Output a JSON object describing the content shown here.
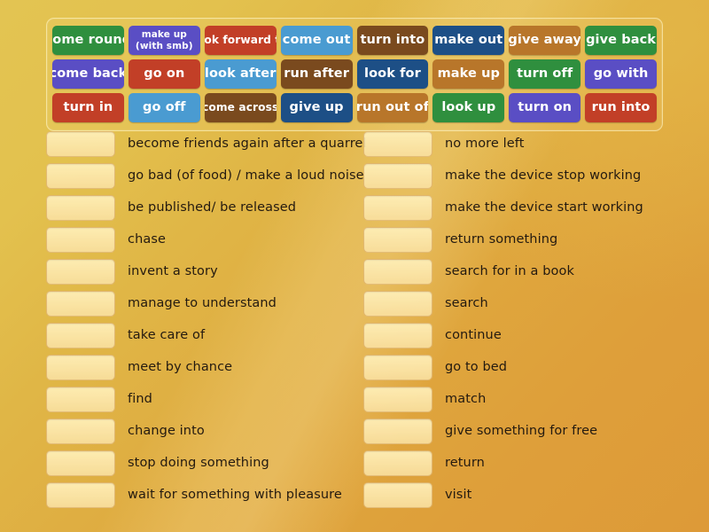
{
  "activity": {
    "type": "match-up",
    "background": {
      "gradient_from": "#e3c452",
      "gradient_to": "#dd9a38"
    }
  },
  "word_bank": {
    "rows": [
      [
        {
          "label": "come round",
          "color": "#2f8f3e",
          "style": "normal"
        },
        {
          "label": "make up\n(with smb)",
          "line1": "make up",
          "line2": "(with smb)",
          "color": "#5a4ec4",
          "style": "twoline"
        },
        {
          "label": "look forward to",
          "color": "#c23f27",
          "style": "small"
        },
        {
          "label": "come out",
          "color": "#4a9bd1",
          "style": "normal"
        },
        {
          "label": "turn into",
          "color": "#7a4a1e",
          "style": "normal"
        },
        {
          "label": "make out",
          "color": "#1d4f86",
          "style": "normal"
        },
        {
          "label": "give away",
          "color": "#b8762a",
          "style": "normal"
        },
        {
          "label": "give back",
          "color": "#2f8f3e",
          "style": "normal"
        }
      ],
      [
        {
          "label": "come back",
          "color": "#5a4ec4",
          "style": "normal"
        },
        {
          "label": "go on",
          "color": "#c23f27",
          "style": "normal"
        },
        {
          "label": "look after",
          "color": "#4a9bd1",
          "style": "normal"
        },
        {
          "label": "run after",
          "color": "#7a4a1e",
          "style": "normal"
        },
        {
          "label": "look for",
          "color": "#1d4f86",
          "style": "normal"
        },
        {
          "label": "make up",
          "color": "#b8762a",
          "style": "normal"
        },
        {
          "label": "turn off",
          "color": "#2f8f3e",
          "style": "normal"
        },
        {
          "label": "go with",
          "color": "#5a4ec4",
          "style": "normal"
        }
      ],
      [
        {
          "label": "turn in",
          "color": "#c23f27",
          "style": "normal"
        },
        {
          "label": "go off",
          "color": "#4a9bd1",
          "style": "normal"
        },
        {
          "label": "come across",
          "color": "#7a4a1e",
          "style": "small"
        },
        {
          "label": "give up",
          "color": "#1d4f86",
          "style": "normal"
        },
        {
          "label": "run out of",
          "color": "#b8762a",
          "style": "normal"
        },
        {
          "label": "look up",
          "color": "#2f8f3e",
          "style": "normal"
        },
        {
          "label": "turn on",
          "color": "#5a4ec4",
          "style": "normal"
        },
        {
          "label": "run into",
          "color": "#c23f27",
          "style": "normal"
        }
      ]
    ]
  },
  "definitions": {
    "left": [
      {
        "text": "become friends again after a quarrel",
        "answer": ""
      },
      {
        "text": "go bad (of food) / make a loud noise",
        "answer": ""
      },
      {
        "text": "be published/ be released",
        "answer": ""
      },
      {
        "text": "chase",
        "answer": ""
      },
      {
        "text": "invent a story",
        "answer": ""
      },
      {
        "text": "manage to understand",
        "answer": ""
      },
      {
        "text": "take care of",
        "answer": ""
      },
      {
        "text": "meet by chance",
        "answer": ""
      },
      {
        "text": "find",
        "answer": ""
      },
      {
        "text": "change into",
        "answer": ""
      },
      {
        "text": "stop doing something",
        "answer": ""
      },
      {
        "text": "wait for something with pleasure",
        "answer": ""
      }
    ],
    "right": [
      {
        "text": "no more left",
        "answer": ""
      },
      {
        "text": "make the device stop working",
        "answer": ""
      },
      {
        "text": "make the device start working",
        "answer": ""
      },
      {
        "text": "return something",
        "answer": ""
      },
      {
        "text": "search for in a book",
        "answer": ""
      },
      {
        "text": "search",
        "answer": ""
      },
      {
        "text": "continue",
        "answer": ""
      },
      {
        "text": "go to bed",
        "answer": ""
      },
      {
        "text": "match",
        "answer": ""
      },
      {
        "text": "give something for free",
        "answer": ""
      },
      {
        "text": "return",
        "answer": ""
      },
      {
        "text": "visit",
        "answer": ""
      }
    ]
  }
}
